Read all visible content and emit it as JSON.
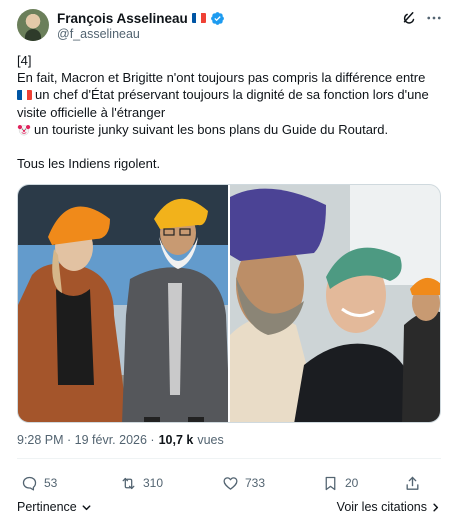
{
  "author": {
    "display_name": "François Asselineau",
    "handle": "@f_asselineau",
    "verified": true
  },
  "tweet": {
    "lines": [
      "[4]",
      "En fait, Macron et Brigitte n'ont toujours pas compris la différence entre",
      "un chef d'État préservant toujours la dignité de sa fonction lors d'une",
      "visite officielle à l'étranger",
      "un touriste junky suivant les bons plans du Guide du Routard.",
      "Tous les Indiens rigolent."
    ],
    "timestamp": "9:28 PM · 19 févr. 2026 ·",
    "views_count": "10,7 k",
    "views_label": "vues"
  },
  "stats": {
    "replies": "53",
    "reposts": "310",
    "likes": "733",
    "bookmarks": "20"
  },
  "footer": {
    "relevance_label": "Pertinence",
    "citations_label": "Voir les citations"
  },
  "icons": {
    "flag": "french-flag-icon",
    "clown": "clown-face-icon",
    "verified": "verified-badge-icon"
  },
  "colors": {
    "accent": "#1d9bf0",
    "muted_text": "#536471",
    "primary_text": "#0f1419",
    "flag_blue": "#0055a4",
    "flag_red": "#ef4135"
  }
}
